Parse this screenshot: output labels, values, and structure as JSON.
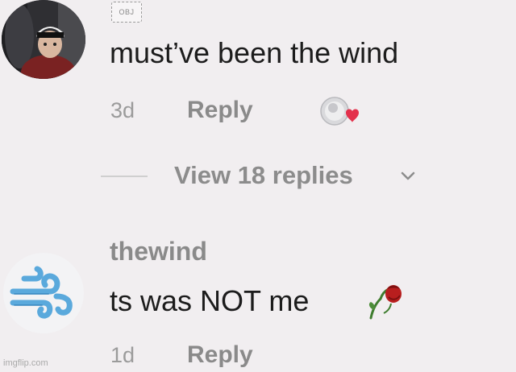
{
  "comment1": {
    "tag": "OBJ",
    "text": "must’ve been the wind",
    "time": "3d",
    "reply_label": "Reply",
    "liked_by_creator": true
  },
  "replies": {
    "label": "View 18 replies"
  },
  "comment2": {
    "username": "thewind",
    "text": "ts was NOT me",
    "time": "1d",
    "reply_label": "Reply"
  },
  "watermark": "imgflip.com",
  "colors": {
    "background": "#f1eef0",
    "text_primary": "#1c1c1c",
    "text_muted": "#8a8a8a",
    "heart": "#e3304b",
    "wind_icon": "#5aa9dc"
  },
  "icons": {
    "liked": "creator-liked-heart-icon",
    "rose": "wilted-rose-icon",
    "chevron": "chevron-down-icon",
    "wind": "wind-face-icon"
  }
}
